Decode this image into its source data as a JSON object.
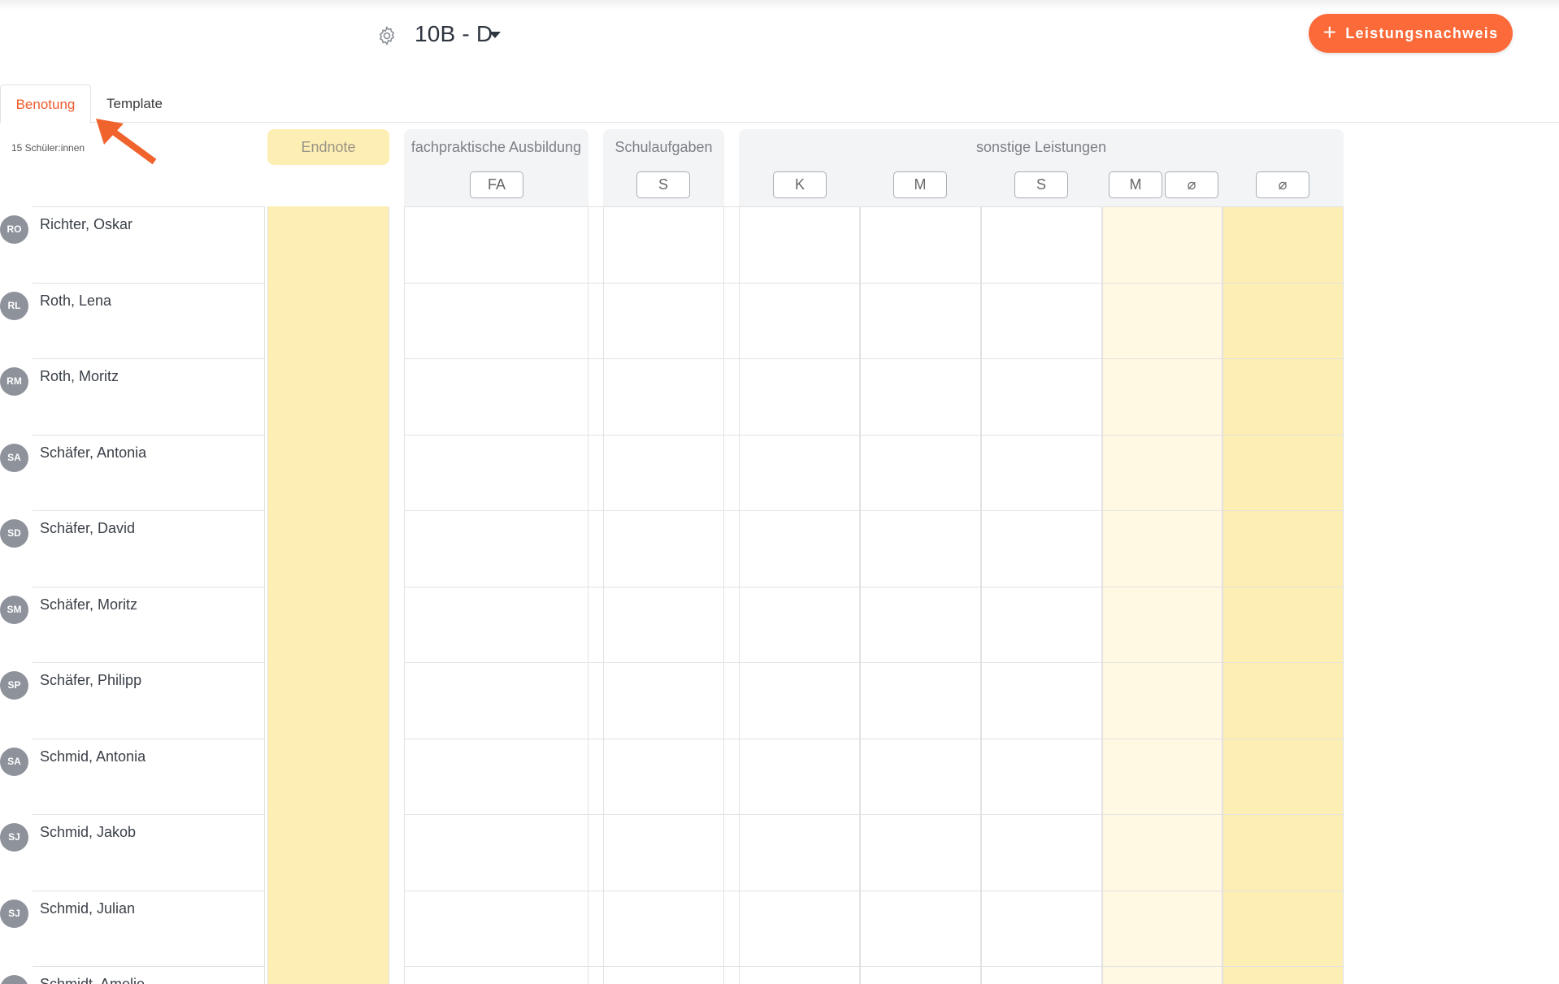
{
  "header": {
    "class_title": "10B - D",
    "add_button_label": "Leistungsnachweis"
  },
  "tabs": [
    {
      "label": "Benotung",
      "active": true
    },
    {
      "label": "Template",
      "active": false
    }
  ],
  "student_count": "15 Schüler:innen",
  "columns": {
    "endnote": "Endnote",
    "fachpraktische": {
      "label": "fachpraktische Ausbildung",
      "chips": [
        "FA"
      ]
    },
    "schulaufgaben": {
      "label": "Schulaufgaben",
      "chips": [
        "S"
      ]
    },
    "sonstige": {
      "label": "sonstige Leistungen",
      "chips": [
        "K",
        "M",
        "S",
        "M",
        "⌀",
        "⌀"
      ]
    }
  },
  "students": [
    {
      "initials": "RO",
      "name": "Richter, Oskar"
    },
    {
      "initials": "RL",
      "name": "Roth, Lena"
    },
    {
      "initials": "RM",
      "name": "Roth, Moritz"
    },
    {
      "initials": "SA",
      "name": "Schäfer, Antonia"
    },
    {
      "initials": "SD",
      "name": "Schäfer, David"
    },
    {
      "initials": "SM",
      "name": "Schäfer, Moritz"
    },
    {
      "initials": "SP",
      "name": "Schäfer, Philipp"
    },
    {
      "initials": "SA",
      "name": "Schmid, Antonia"
    },
    {
      "initials": "SJ",
      "name": "Schmid, Jakob"
    },
    {
      "initials": "SJ",
      "name": "Schmid, Julian"
    },
    {
      "initials": "SA",
      "name": "Schmidt, Amelie"
    }
  ],
  "colors": {
    "accent": "#fb6a38",
    "endnote_yellow": "#fdeeb3",
    "light_yellow": "#fff8e2",
    "header_gray": "#f3f4f6"
  }
}
